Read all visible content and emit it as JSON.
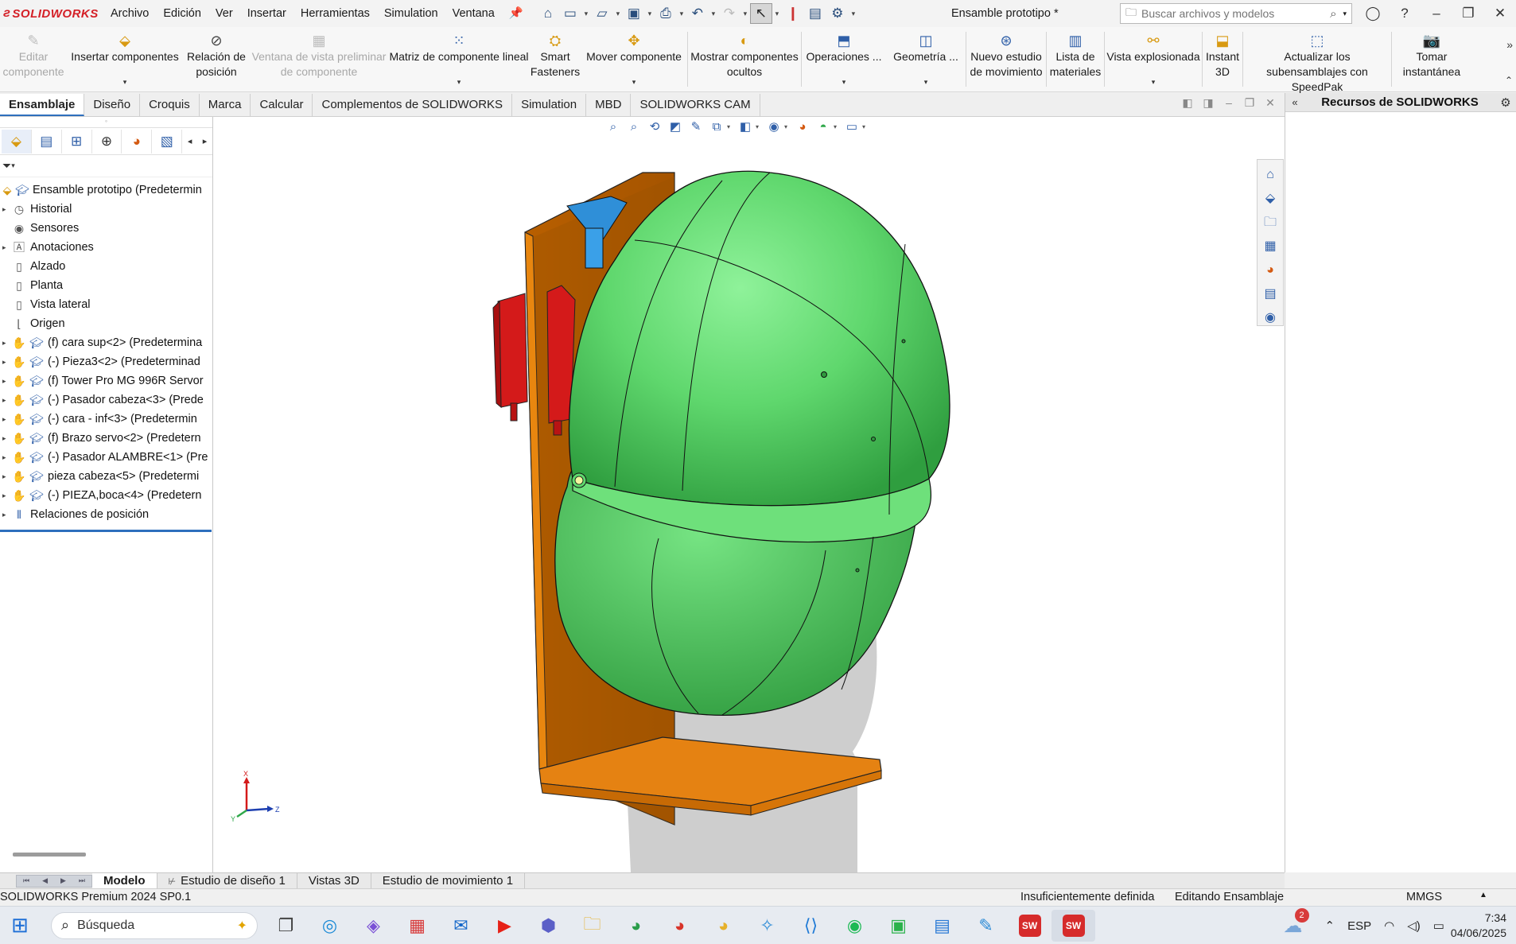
{
  "app": {
    "brand": "SOLIDWORKS",
    "document_title": "Ensamble prototipo *"
  },
  "menu": [
    "Archivo",
    "Edición",
    "Ver",
    "Insertar",
    "Herramientas",
    "Simulation",
    "Ventana"
  ],
  "search": {
    "placeholder": "Buscar archivos y modelos"
  },
  "command_manager": [
    {
      "label": "Editar componente",
      "icon": "edit-component-icon",
      "disabled": true
    },
    {
      "label": "Insertar componentes",
      "icon": "insert-components-icon",
      "disabled": false
    },
    {
      "label": "Relación de posición",
      "icon": "mate-icon",
      "disabled": false
    },
    {
      "label": "Ventana de vista preliminar de componente",
      "icon": "preview-window-icon",
      "disabled": true
    },
    {
      "label": "Matriz de componente lineal",
      "icon": "linear-pattern-icon",
      "disabled": false
    },
    {
      "label": "Smart Fasteners",
      "icon": "smart-fasteners-icon",
      "disabled": false
    },
    {
      "label": "Mover componente",
      "icon": "move-component-icon",
      "disabled": false
    },
    {
      "label": "Mostrar componentes ocultos",
      "icon": "show-hidden-icon",
      "disabled": false
    },
    {
      "label": "Operaciones ...",
      "icon": "features-icon",
      "disabled": false
    },
    {
      "label": "Geometría ...",
      "icon": "reference-geometry-icon",
      "disabled": false
    },
    {
      "label": "Nuevo estudio de movimiento",
      "icon": "motion-study-icon",
      "disabled": false
    },
    {
      "label": "Lista de materiales",
      "icon": "bom-icon",
      "disabled": false
    },
    {
      "label": "Vista explosionada",
      "icon": "exploded-view-icon",
      "disabled": false
    },
    {
      "label": "Instant 3D",
      "icon": "instant3d-icon",
      "disabled": false
    },
    {
      "label": "Actualizar los subensamblajes con SpeedPak",
      "icon": "speedpak-icon",
      "disabled": false
    },
    {
      "label": "Tomar instantánea",
      "icon": "camera-icon",
      "disabled": false
    }
  ],
  "tabs": [
    "Ensamblaje",
    "Diseño",
    "Croquis",
    "Marca",
    "Calcular",
    "Complementos de SOLIDWORKS",
    "Simulation",
    "MBD",
    "SOLIDWORKS CAM"
  ],
  "active_tab": "Ensamblaje",
  "feature_tree": {
    "root": "Ensamble prototipo (Predetermin",
    "items": [
      {
        "label": "Historial",
        "icon": "history-icon",
        "expandable": true
      },
      {
        "label": "Sensores",
        "icon": "sensor-icon",
        "expandable": false
      },
      {
        "label": "Anotaciones",
        "icon": "annotations-icon",
        "expandable": true
      },
      {
        "label": "Alzado",
        "icon": "plane-icon",
        "expandable": false
      },
      {
        "label": "Planta",
        "icon": "plane-icon",
        "expandable": false
      },
      {
        "label": "Vista lateral",
        "icon": "plane-icon",
        "expandable": false
      },
      {
        "label": "Origen",
        "icon": "origin-icon",
        "expandable": false
      },
      {
        "label": "(f) cara sup<2> (Predetermina",
        "icon": "part-icon",
        "expandable": true
      },
      {
        "label": "(-) Pieza3<2> (Predeterminad",
        "icon": "part-icon",
        "expandable": true
      },
      {
        "label": "(f) Tower Pro MG 996R Servor",
        "icon": "part-icon",
        "expandable": true
      },
      {
        "label": "(-) Pasador cabeza<3> (Prede",
        "icon": "part-icon",
        "expandable": true
      },
      {
        "label": "(-) cara - inf<3> (Predetermin",
        "icon": "part-icon",
        "expandable": true
      },
      {
        "label": "(f) Brazo servo<2> (Predetern",
        "icon": "part-icon",
        "expandable": true
      },
      {
        "label": "(-) Pasador ALAMBRE<1> (Pre",
        "icon": "part-icon",
        "expandable": true
      },
      {
        "label": "pieza cabeza<5> (Predetermi",
        "icon": "part-icon",
        "expandable": true
      },
      {
        "label": "(-) PIEZA,boca<4> (Predetern",
        "icon": "part-icon",
        "expandable": true
      },
      {
        "label": "Relaciones de posición",
        "icon": "mates-icon",
        "expandable": true
      }
    ]
  },
  "task_pane": {
    "title": "Recursos de SOLIDWORKS"
  },
  "bottom_tabs": [
    "Modelo",
    "Estudio de diseño 1",
    "Vistas 3D",
    "Estudio de movimiento 1"
  ],
  "active_bottom_tab": "Modelo",
  "status_bar": {
    "product": "SOLIDWORKS Premium 2024 SP0.1",
    "definition": "Insuficientemente definida",
    "mode": "Editando Ensamblaje",
    "units": "MMGS"
  },
  "triad": {
    "x": "X",
    "y": "Y",
    "z": "Z"
  },
  "taskbar": {
    "search_placeholder": "Búsqueda",
    "language": "ESP",
    "time": "7:34",
    "date": "04/06/2025",
    "notification_count": "2"
  },
  "colors": {
    "head": "#4fcf5f",
    "head_dark": "#37a84a",
    "stand": "#e17d0a",
    "stand_dark": "#b85f00",
    "servo": "#d41a1a",
    "bracket": "#2f8fd8",
    "accent": "#2e6fbd"
  }
}
